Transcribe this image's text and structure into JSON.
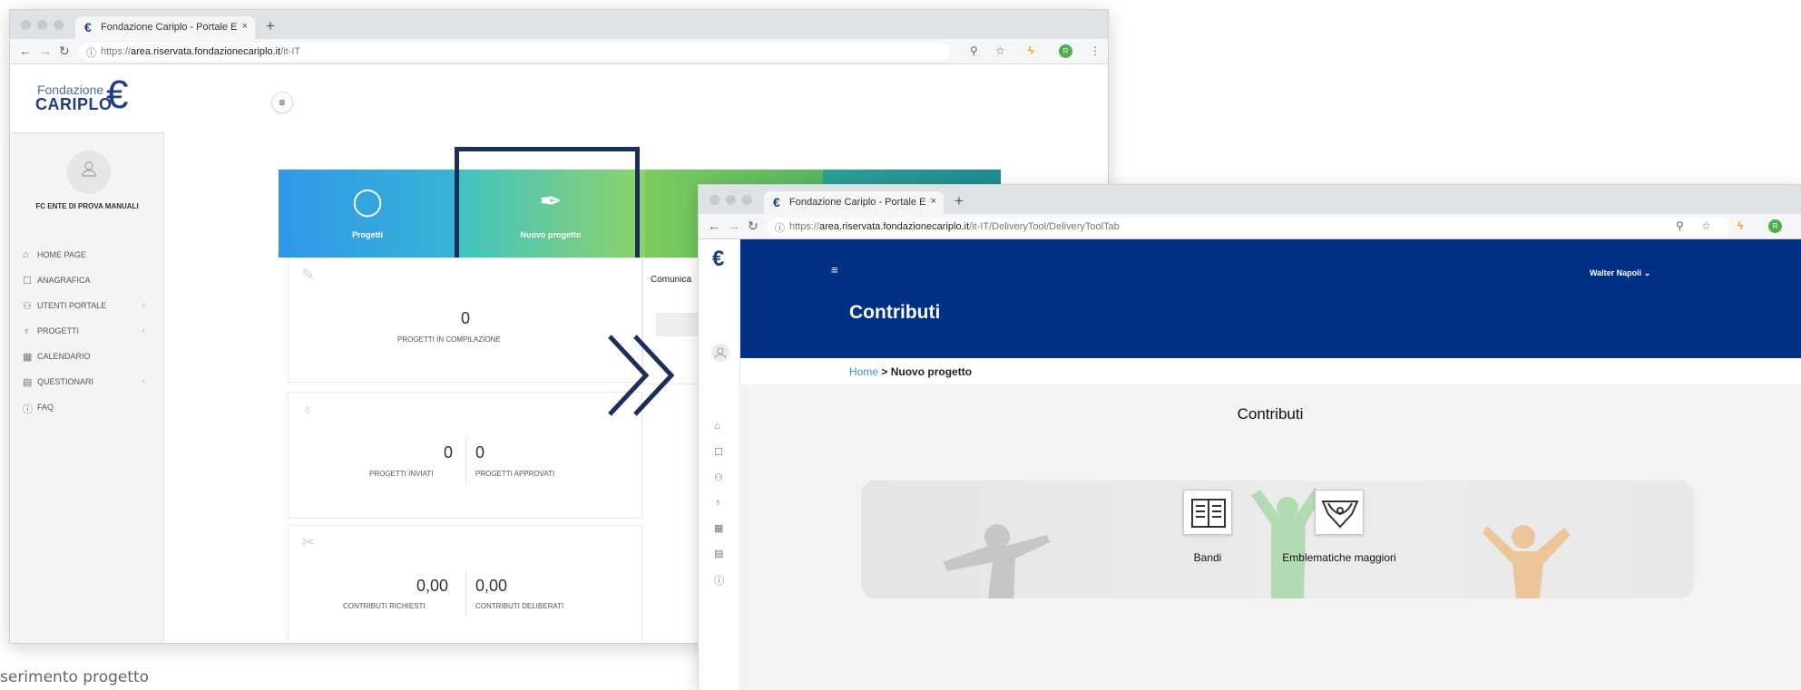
{
  "caption": "serimento progetto",
  "arrow": "»",
  "left_window": {
    "tab_title": "Fondazione Cariplo - Portale E",
    "tab_favicon": "€",
    "tab_close": "×",
    "new_tab": "+",
    "url_scheme": "https://",
    "url_host": "area.riservata.fondazionecariplo.it",
    "url_path": "/it-IT",
    "extension_badge": "R",
    "logo": {
      "line1": "Fondazione",
      "line2": "CARIPLO",
      "mark": "€"
    },
    "org_name": "FC ENTE DI PROVA MANUALI",
    "menu": [
      {
        "label": "HOME PAGE",
        "icon": "home-icon",
        "glyph": "⌂",
        "chevron": ""
      },
      {
        "label": "ANAGRAFICA",
        "icon": "id-card-icon",
        "glyph": "☐",
        "chevron": ""
      },
      {
        "label": "UTENTI PORTALE",
        "icon": "users-icon",
        "glyph": "⚇",
        "chevron": "‹"
      },
      {
        "label": "PROGETTI",
        "icon": "lightbulb-icon",
        "glyph": "♁",
        "chevron": "‹"
      },
      {
        "label": "CALENDARIO",
        "icon": "calendar-icon",
        "glyph": "▦",
        "chevron": ""
      },
      {
        "label": "QUESTIONARI",
        "icon": "survey-icon",
        "glyph": "▤",
        "chevron": "‹"
      },
      {
        "label": "FAQ",
        "icon": "info-icon",
        "glyph": "ⓘ",
        "chevron": ""
      }
    ],
    "menu_toggle": "≡",
    "tiles": {
      "progetti": "Progetti",
      "nuovo_progetto": "Nuovo progetto"
    },
    "comunica": "Comunica",
    "stats": {
      "in_compilazione_value": "0",
      "in_compilazione_label": "PROGETTI IN COMPILAZIONE",
      "inviati_value": "0",
      "inviati_label": "PROGETTI INVIATI",
      "approvati_value": "0",
      "approvati_label": "PROGETTI APPROVATI",
      "richiesti_value": "0,00",
      "richiesti_label": "CONTRIBUTI RICHIESTI",
      "deliberati_value": "0,00",
      "deliberati_label": "CONTRIBUTI DELIBERATI"
    }
  },
  "right_window": {
    "tab_title": "Fondazione Cariplo - Portale E",
    "tab_favicon": "€",
    "tab_close": "×",
    "new_tab": "+",
    "url_scheme": "https://",
    "url_host": "area.riservata.fondazionecariplo.it",
    "url_path": "/it-IT/DeliveryTool/DeliveryToolTab",
    "extension_badge": "R",
    "user_name": "Walter Napoli",
    "user_chevron": "⌄",
    "menu_toggle": "≡",
    "header_title": "Contributi",
    "breadcrumb_home": "Home",
    "breadcrumb_sep": " > ",
    "breadcrumb_current": "Nuovo progetto",
    "section_title": "Contributi",
    "buttons": [
      {
        "label": "Bandi",
        "icon": "document-icon"
      },
      {
        "label": "Emblematiche maggiori",
        "icon": "emblem-icon"
      }
    ]
  },
  "colors": {
    "brand_navy": "#003085",
    "highlight_border": "#1b2f5a",
    "link_blue": "#3b8eea",
    "tile_blue": "#2f97ea",
    "tile_green": "#8fd26a",
    "tile_teal": "#2aa197"
  }
}
